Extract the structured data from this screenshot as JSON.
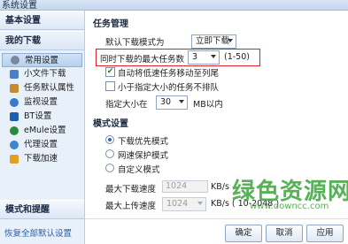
{
  "window": {
    "title": "系统设置"
  },
  "sidebar": {
    "basic_header": "基本设置",
    "download_header": "我的下载",
    "items": [
      {
        "label": "常用设置",
        "icon": "gear-icon",
        "color": "#7a8899",
        "active": true
      },
      {
        "label": "小文件下载",
        "icon": "file-icon",
        "color": "#4a7fc8",
        "active": false
      },
      {
        "label": "任务默认属性",
        "icon": "task-icon",
        "color": "#c78a2e",
        "active": false
      },
      {
        "label": "监视设置",
        "icon": "monitor-icon",
        "color": "#3a78c8",
        "active": false
      },
      {
        "label": "BT设置",
        "icon": "bt-icon",
        "color": "#1f5fb0",
        "active": false
      },
      {
        "label": "eMule设置",
        "icon": "emule-icon",
        "color": "#2c8a3c",
        "active": false
      },
      {
        "label": "代理设置",
        "icon": "proxy-icon",
        "color": "#3e86d0",
        "active": false
      },
      {
        "label": "下载加速",
        "icon": "lightning-icon",
        "color": "#e0a020",
        "active": false
      }
    ],
    "mode_header": "模式和提醒",
    "restore_link": "恢复全部默认设置"
  },
  "task_mgmt": {
    "title": "任务管理",
    "default_mode_label": "默认下载模式为",
    "default_mode_value": "立即下载",
    "max_tasks_label": "同时下载的最大任务数",
    "max_tasks_value": "3",
    "max_tasks_range": "(1-50)",
    "auto_move_label": "自动将低速任务移动至列尾",
    "auto_move_checked": true,
    "no_queue_label": "小于指定大小的任务不排队",
    "no_queue_checked": false,
    "size_label": "指定大小在",
    "size_value": "30",
    "size_unit": "MB以内"
  },
  "mode": {
    "title": "模式设置",
    "options": [
      {
        "label": "下载优先模式",
        "selected": true
      },
      {
        "label": "网速保护模式",
        "selected": false
      },
      {
        "label": "自定义模式",
        "selected": false
      }
    ],
    "max_down_label": "最大下载速度",
    "max_down_value": "1024",
    "max_down_unit": "KB/s",
    "max_up_label": "最大上传速度",
    "max_up_value": "1024",
    "max_up_unit": "KB/s ( 10-2048 )"
  },
  "buttons": {
    "ok": "确定",
    "cancel": "取消",
    "apply": "应用"
  },
  "watermark": {
    "text": "绿色资源网",
    "url": "www.downcc.com"
  }
}
